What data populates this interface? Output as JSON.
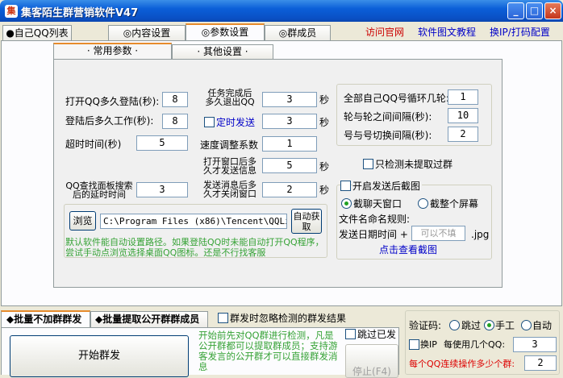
{
  "window": {
    "title": "集客陌生群营销软件V47",
    "minimize": "_",
    "maximize": "□",
    "close": "×",
    "app_icon_glyph": "集"
  },
  "tabs": [
    {
      "label": "●自己QQ列表"
    },
    {
      "label": "◎内容设置"
    },
    {
      "label": "◎参数设置"
    },
    {
      "label": "◎群成员"
    }
  ],
  "links": {
    "official_site": "访问官网",
    "tutorial": "软件图文教程",
    "change_ip": "换IP/打码配置"
  },
  "subtabs": [
    {
      "label": "· 常用参数 ·"
    },
    {
      "label": "· 其他设置 ·"
    }
  ],
  "params": {
    "login_interval_label": "打开QQ多久登陆(秒):",
    "login_interval": "8",
    "work_after_login_label": "登陆后多久工作(秒):",
    "work_after_login": "8",
    "timeout_label": "超时时间(秒)",
    "timeout": "5",
    "panel_search_delay_label": "QQ查找面板搜索后的延时时间",
    "panel_search_delay": "3",
    "quit_after_task_label": "任务完成后多久退出QQ",
    "quit_after_task": "3",
    "timed_send_label": "定时发送",
    "timed_send": "3",
    "speed_factor_label": "速度调整系数",
    "speed_factor": "1",
    "send_after_open_label": "打开窗口后多久才发送信息",
    "send_after_open": "5",
    "close_after_send_label": "发送消息后多久才关闭窗口",
    "close_after_send": "2",
    "sec_unit": "秒"
  },
  "right_params": {
    "all_qq_loop_label": "全部自己QQ号循环几轮:",
    "all_qq_loop": "1",
    "round_interval_label": "轮与轮之间间隔(秒):",
    "round_interval": "10",
    "account_switch_label": "号与号切换间隔(秒):",
    "account_switch": "2",
    "only_unextracted_label": "只检测未提取过群"
  },
  "screenshot_group": {
    "enable_label": "开启发送后截图",
    "chat_window_label": "截聊天窗口",
    "full_screen_label": "截整个屏幕",
    "filename_rule_label": "文件名命名规则:",
    "send_date_label": "发送日期时间 +",
    "extra_name_placeholder": "可以不填",
    "ext": ".jpg",
    "view_link": "点击查看截图"
  },
  "browse": {
    "button": "浏览",
    "path": "C:\\Program Files (x86)\\Tencent\\QQLite\\Bin\\QQ.exe",
    "auto_get": "自动获取",
    "hint": "默认软件能自动设置路径。如果登陆QQ时未能自动打开QQ程序，尝试手动点浏览选择桌面QQ图标。还是不行找客服"
  },
  "bottom": {
    "tab_no_add": "◆批量不加群群发",
    "tab_extract": "◆批量提取公开群群成员",
    "ignore_detect_label": "群发时忽略检测的群发结果",
    "start_button": "开始群发",
    "start_hint": "开始前先对QQ群进行检测，凡是公开群都可以提取群成员；支持游客发言的公开群才可以直接群发消息",
    "skip_sent_label": "跳过已发",
    "stop_button": "停止(F4)"
  },
  "captcha": {
    "label": "验证码:",
    "skip": "跳过",
    "manual": "手工",
    "auto": "自动",
    "change_ip_label": "换IP",
    "every_qq_label": "每使用几个QQ:",
    "every_qq": "3",
    "groups_per_qq_label": "每个QQ连续操作多少个群:",
    "groups_per_qq": "2"
  }
}
